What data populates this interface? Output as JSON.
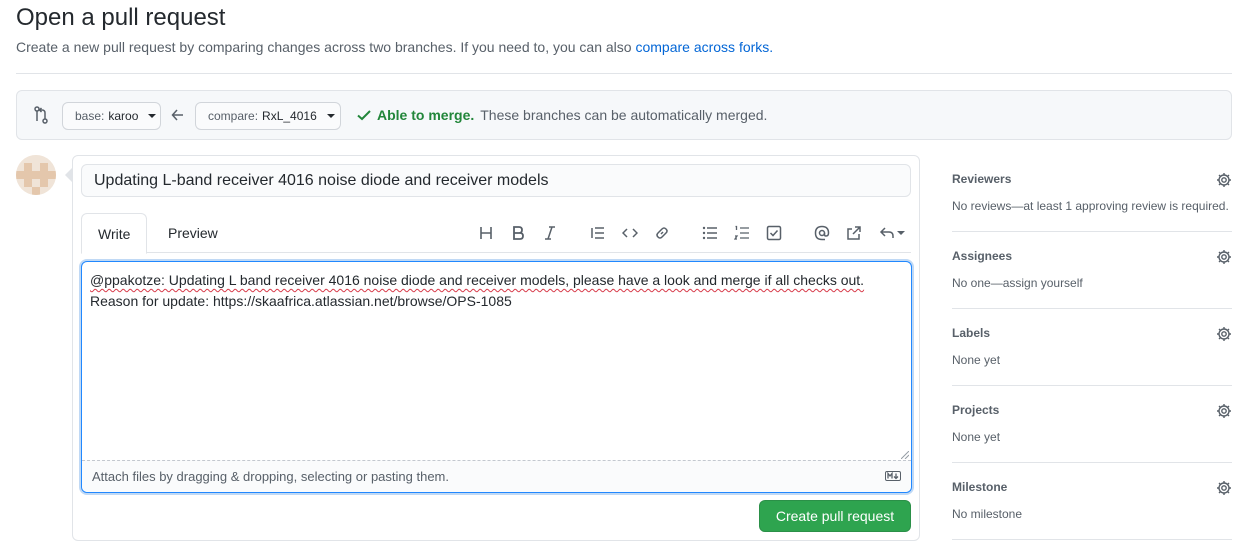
{
  "page": {
    "title": "Open a pull request",
    "subtitle_text": "Create a new pull request by comparing changes across two branches. If you need to, you can also ",
    "subtitle_link": "compare across forks."
  },
  "range": {
    "base_prefix": "base: ",
    "base_branch": "karoo",
    "compare_prefix": "compare: ",
    "compare_branch": "RxL_4016",
    "merge_ok": "Able to merge.",
    "merge_text": "These branches can be automatically merged."
  },
  "composer": {
    "title_value": "Updating L-band receiver 4016 noise diode and receiver models",
    "tabs": [
      "Write",
      "Preview"
    ],
    "toolbar_icons": [
      "heading-icon",
      "bold-icon",
      "italic-icon",
      "quote-icon",
      "code-icon",
      "link-icon",
      "bulleted-list-icon",
      "numbered-list-icon",
      "task-list-icon",
      "mention-icon",
      "cross-reference-icon",
      "saved-reply-icon"
    ],
    "body_line1": "@ppakotze: Updating L band receiver 4016 noise diode and receiver models, please have a look and merge if all checks out.",
    "body_line2": "Reason for update: https://skaafrica.atlassian.net/browse/OPS-1085",
    "attach_text": "Attach files by dragging & dropping, selecting or pasting them.",
    "submit_label": "Create pull request"
  },
  "sidebar": {
    "sections": [
      {
        "heading": "Reviewers",
        "value": "No reviews—at least 1 approving review is required."
      },
      {
        "heading": "Assignees",
        "value": "No one—assign yourself"
      },
      {
        "heading": "Labels",
        "value": "None yet"
      },
      {
        "heading": "Projects",
        "value": "None yet"
      },
      {
        "heading": "Milestone",
        "value": "No milestone"
      }
    ]
  },
  "colors": {
    "accent_blue": "#0366d6",
    "success_green": "#2ea44f",
    "merge_green": "#22863a"
  }
}
